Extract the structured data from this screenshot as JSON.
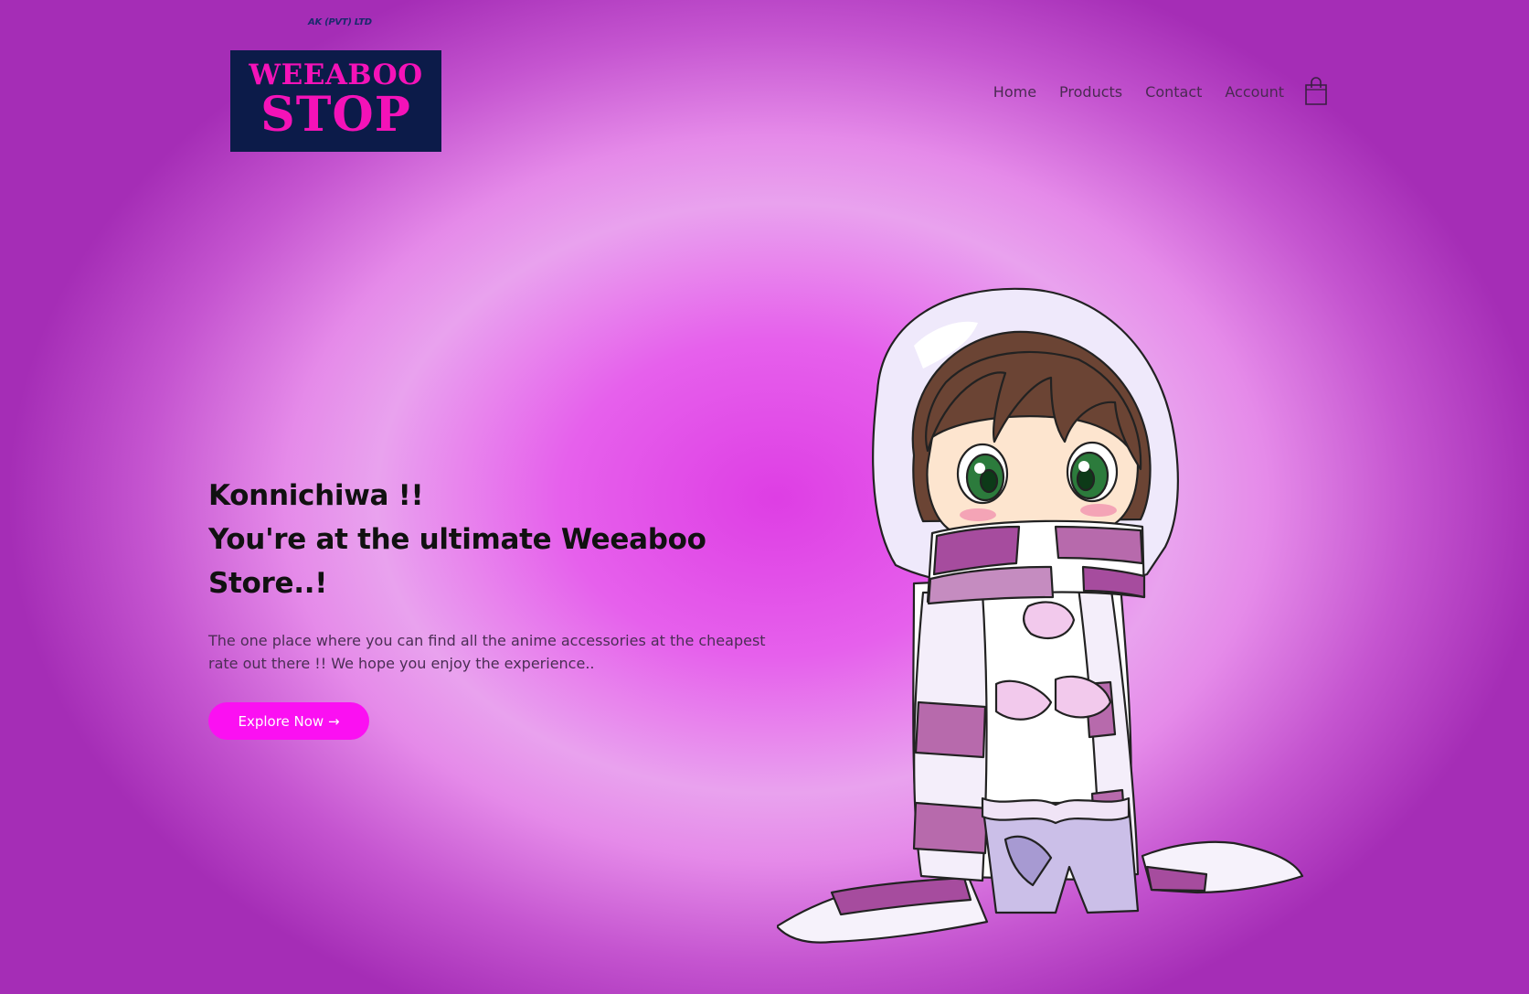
{
  "header": {
    "tagline": "AK (PVT) LTD",
    "logo_line1": "WEEABOO",
    "logo_line2": "STOP"
  },
  "nav": {
    "items": [
      {
        "label": "Home"
      },
      {
        "label": "Products"
      },
      {
        "label": "Contact"
      },
      {
        "label": "Account"
      }
    ],
    "cart_icon": "shopping-bag-icon"
  },
  "hero": {
    "title_line1": "Konnichiwa !!",
    "title_line2": "You're at the ultimate Weeaboo",
    "title_line3": "Store..!",
    "description": "The one place where you can find all the anime accessories at the cheapest rate out there !! We hope you enjoy the experience..",
    "cta_label": "Explore Now →"
  },
  "colors": {
    "accent": "#fb10f2",
    "logo_bg": "#0c1b49",
    "logo_text": "#f412b8",
    "background_center": "#de3ee4"
  }
}
